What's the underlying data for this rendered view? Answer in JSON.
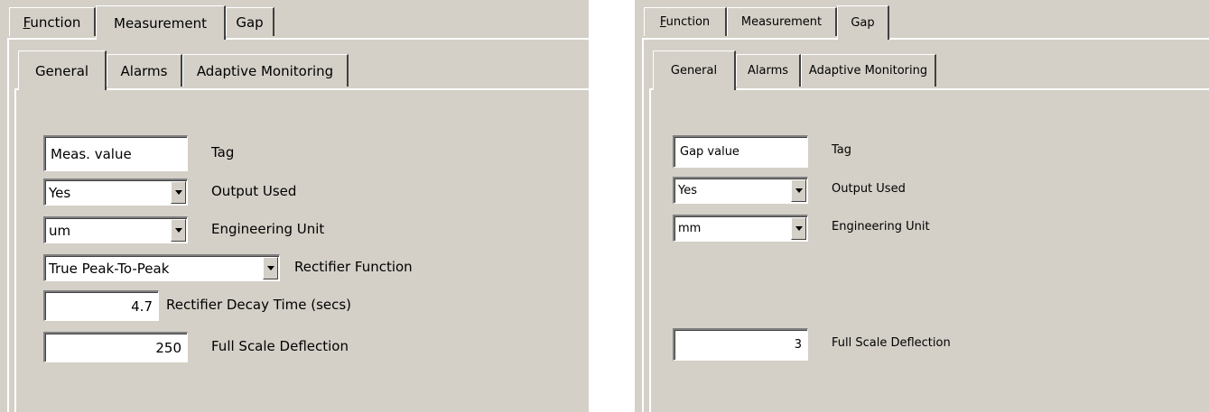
{
  "left": {
    "tabs": {
      "function_pre": "",
      "function_ul": "F",
      "function_post": "unction",
      "measurement": "Measurement",
      "gap": "Gap"
    },
    "subtabs": {
      "general": "General",
      "alarms": "Alarms",
      "adaptive": "Adaptive Monitoring"
    },
    "fields": {
      "tag_value": "Meas. value",
      "tag_label": "Tag",
      "output_value": "Yes",
      "output_label": "Output Used",
      "unit_value": "um",
      "unit_label": "Engineering Unit",
      "rectifier_value": "True Peak-To-Peak",
      "rectifier_label": "Rectifier Function",
      "decay_value": "4.7",
      "decay_label": "Rectifier Decay Time (secs)",
      "fsd_value": "250",
      "fsd_label": "Full Scale Deflection"
    }
  },
  "right": {
    "tabs": {
      "function_ul": "F",
      "function_post": "unction",
      "measurement": "Measurement",
      "gap": "Gap"
    },
    "subtabs": {
      "general": "General",
      "alarms": "Alarms",
      "adaptive": "Adaptive Monitoring"
    },
    "fields": {
      "tag_value": "Gap value",
      "tag_label": "Tag",
      "output_value": "Yes",
      "output_label": "Output Used",
      "unit_value": "mm",
      "unit_label": "Engineering Unit",
      "fsd_value": "3",
      "fsd_label": "Full Scale Deflection"
    }
  }
}
